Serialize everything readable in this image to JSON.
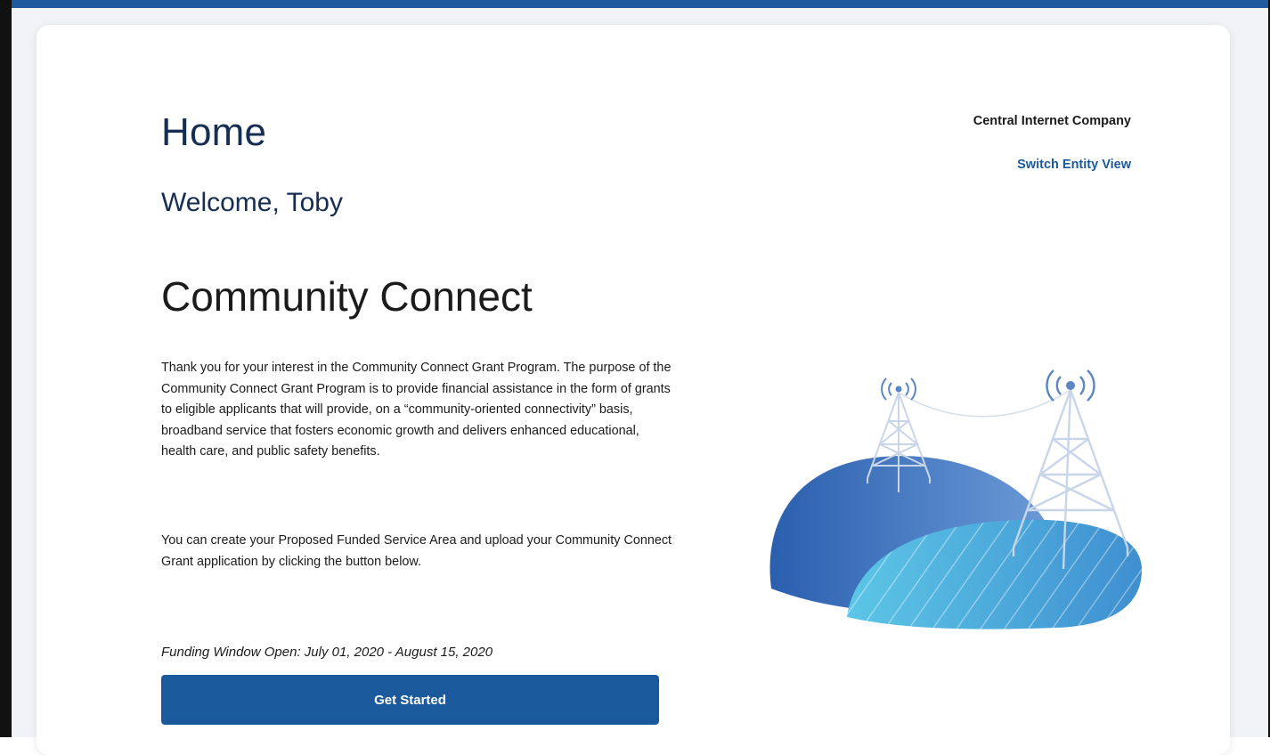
{
  "header": {
    "title": "Home",
    "welcome": "Welcome, Toby"
  },
  "entity": {
    "name": "Central Internet Company",
    "switch_label": "Switch Entity View"
  },
  "program": {
    "title": "Community Connect",
    "description": "Thank you for your interest in the Community Connect Grant Program. The purpose of the Community Connect Grant Program is to provide financial assistance in the form of grants to eligible applicants that will provide, on a “community-oriented connectivity” basis, broadband service that fosters economic growth and delivers enhanced educational, health care, and public safety benefits.",
    "instructions": "You can create your Proposed Funded Service Area and upload your Community Connect Grant application by clicking the button below.",
    "funding_window": "Funding Window Open: July 01, 2020 - August 15, 2020",
    "cta_label": "Get Started"
  },
  "colors": {
    "primary": "#1a5a9c",
    "heading": "#162e51",
    "hill_dark": "#2f67b3",
    "hill_light": "#5bbfe3",
    "tower": "#c7d4e8"
  },
  "icons": {
    "illustration": "broadband-towers-illustration"
  }
}
